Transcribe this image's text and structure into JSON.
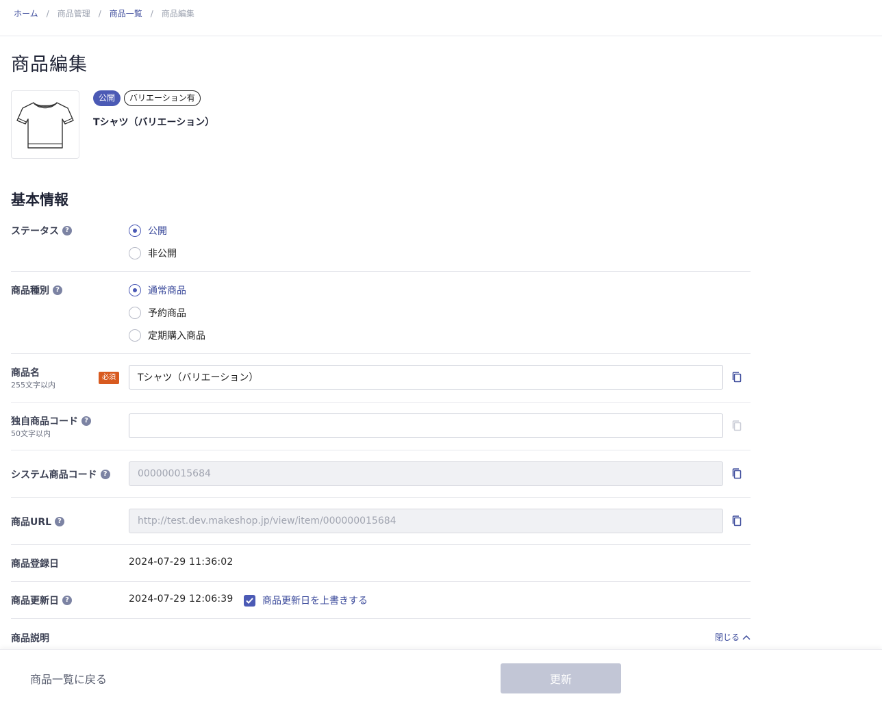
{
  "breadcrumb": {
    "items": [
      "ホーム",
      "商品管理",
      "商品一覧",
      "商品編集"
    ],
    "separator": "/"
  },
  "page_title": "商品編集",
  "product": {
    "status_badge": "公開",
    "variation_badge": "バリエーション有",
    "name": "Tシャツ（バリエーション）",
    "image_icon": "tshirt-icon"
  },
  "section_title": "基本情報",
  "fields": {
    "status": {
      "label": "ステータス",
      "options": [
        "公開",
        "非公開"
      ],
      "selected": "公開"
    },
    "product_type": {
      "label": "商品種別",
      "options": [
        "通常商品",
        "予約商品",
        "定期購入商品"
      ],
      "selected": "通常商品"
    },
    "product_name": {
      "label": "商品名",
      "sublabel": "255文字以内",
      "required": "必須",
      "value": "Tシャツ（バリエーション）"
    },
    "custom_code": {
      "label": "独自商品コード",
      "sublabel": "50文字以内",
      "value": ""
    },
    "system_code": {
      "label": "システム商品コード",
      "value": "000000015684"
    },
    "product_url": {
      "label": "商品URL",
      "value": "http://test.dev.makeshop.jp/view/item/000000015684"
    },
    "registered_date": {
      "label": "商品登録日",
      "value": "2024-07-29 11:36:02"
    },
    "updated_date": {
      "label": "商品更新日",
      "value": "2024-07-29 12:06:39",
      "overwrite_label": "商品更新日を上書きする",
      "overwrite_checked": true
    },
    "description": {
      "label": "商品説明",
      "toggle_label": "閉じる"
    }
  },
  "footer": {
    "back_label": "商品一覧に戻る",
    "update_label": "更新"
  },
  "colors": {
    "accent": "#4b5ab5",
    "required": "#d85a1f",
    "disabled_button": "#c2c6d6"
  }
}
